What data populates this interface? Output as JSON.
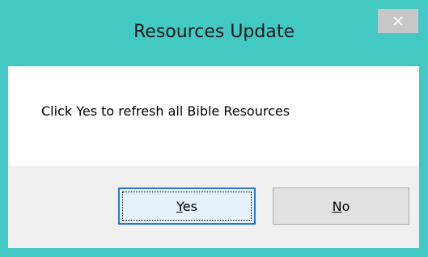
{
  "window": {
    "title": "Resources Update",
    "close_icon": "close-icon",
    "accent_color": "#44c8c4"
  },
  "message": {
    "text": "Click Yes to refresh all Bible Resources"
  },
  "buttons": {
    "yes": {
      "mnemonic": "Y",
      "rest": "es"
    },
    "no": {
      "mnemonic": "N",
      "rest": "o"
    }
  }
}
